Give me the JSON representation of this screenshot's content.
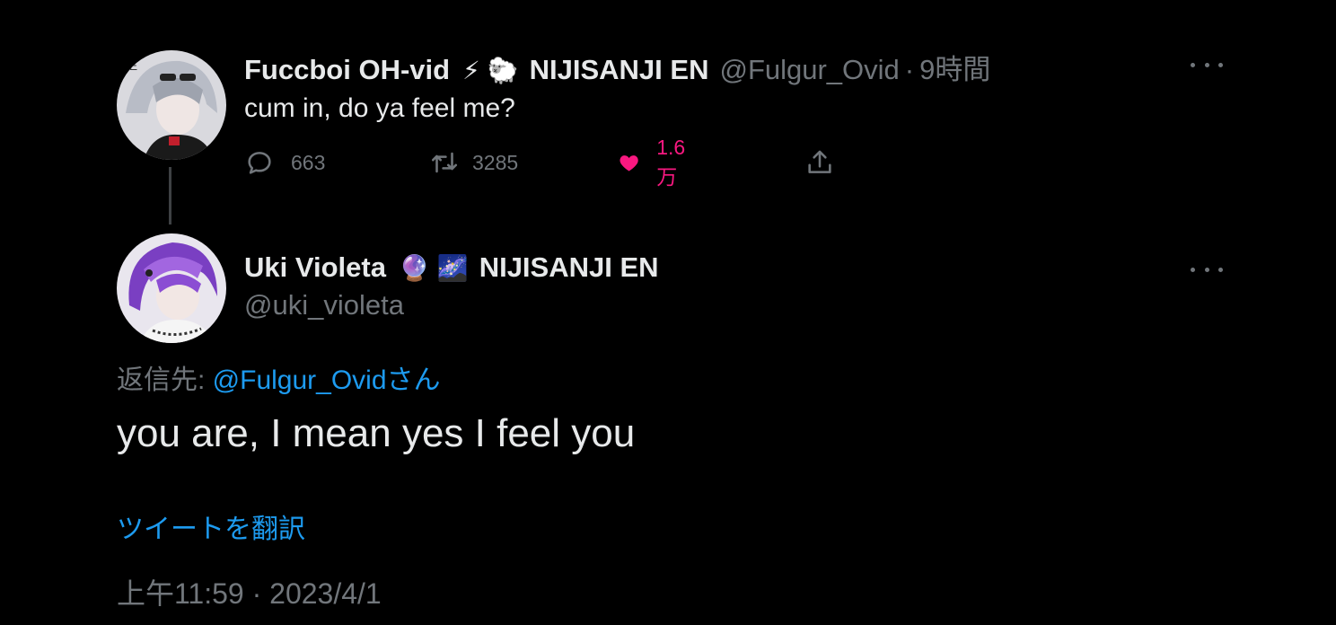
{
  "parent_tweet": {
    "display_name": "Fuccboi OH-vid",
    "emoji_1": "⚡",
    "emoji_2": "🐑",
    "tag": "NIJISANJI EN",
    "handle": "@Fulgur_Ovid",
    "separator": "·",
    "time": "9時間",
    "text": "cum in, do ya feel me?",
    "actions": {
      "replies": "663",
      "retweets": "3285",
      "likes": "1.6万"
    },
    "avatar_icon": "avatar-silver-hair-icon"
  },
  "main_tweet": {
    "display_name": "Uki Violeta",
    "emoji_1": "🔮",
    "emoji_2": "🌌",
    "tag": "NIJISANJI EN",
    "handle": "@uki_violeta",
    "reply_prefix": "返信先: ",
    "reply_handle": "@Fulgur_Ovidさん",
    "text": "you are, I mean yes I feel you",
    "translate_label": "ツイートを翻訳",
    "timestamp": "上午11:59 · 2023/4/1",
    "avatar_icon": "avatar-purple-hair-icon"
  },
  "colors": {
    "background": "#000000",
    "text": "#e7e9ea",
    "muted": "#71767b",
    "link": "#1d9bf0",
    "like": "#f91880"
  }
}
